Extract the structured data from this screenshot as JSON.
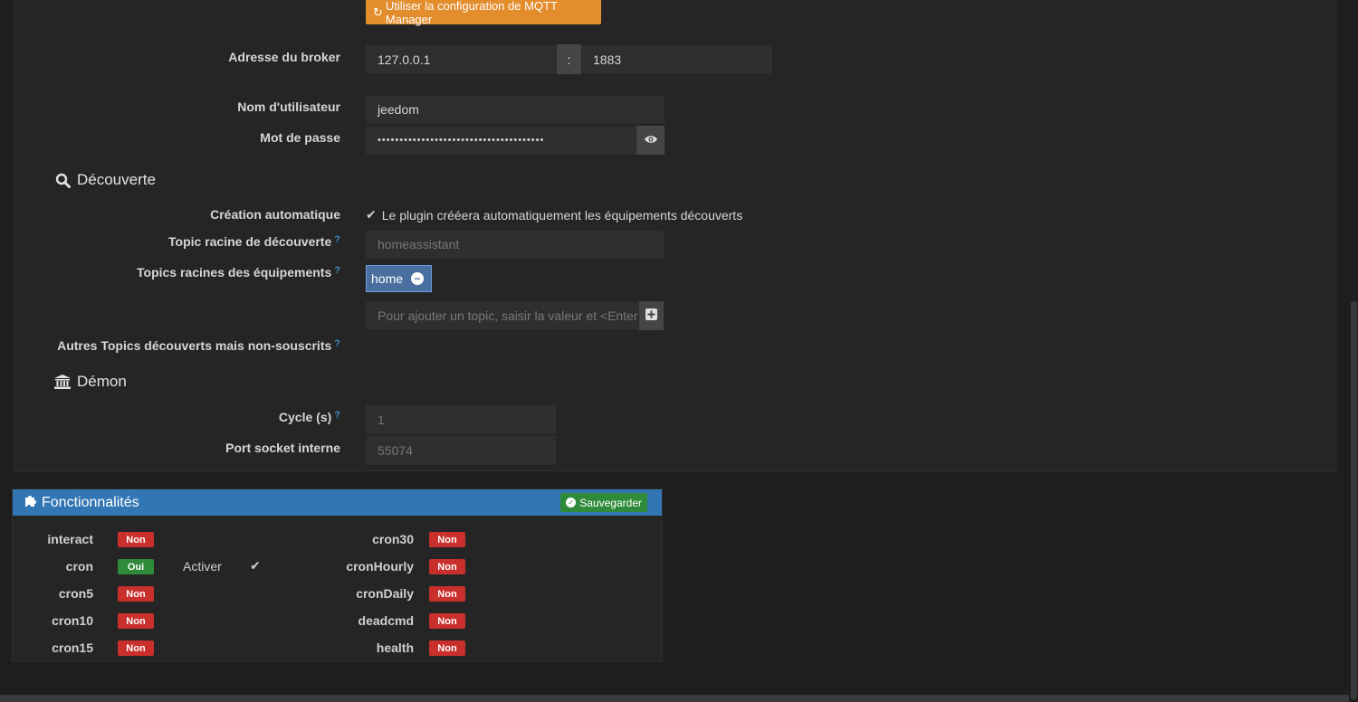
{
  "mqtt_button": {
    "icon": "refresh-icon",
    "label": "Utiliser la configuration de MQTT Manager"
  },
  "broker": {
    "label": "Adresse du broker",
    "host": "127.0.0.1",
    "separator": ":",
    "port": "1883"
  },
  "username": {
    "label": "Nom d'utilisateur",
    "value": "jeedom"
  },
  "password": {
    "label": "Mot de passe",
    "value": "••••••••••••••••••••••••••••••••••••••",
    "toggle_icon": "eye-icon"
  },
  "discovery": {
    "title": "Découverte",
    "icon": "search-icon",
    "auto_creation_label": "Création automatique",
    "auto_creation_text": "Le plugin crééera automatiquement les équipements découverts",
    "auto_creation_checked": true,
    "root_topic_label": "Topic racine de découverte",
    "root_topic_placeholder": "homeassistant",
    "equipment_topics_label": "Topics racines des équipements",
    "topics": [
      "home"
    ],
    "add_topic_placeholder": "Pour ajouter un topic, saisir la valeur et <Enter>",
    "other_topics_label": "Autres Topics découverts mais non-souscrits",
    "help_icon": "?"
  },
  "daemon": {
    "title": "Démon",
    "icon": "bank-icon",
    "cycle_label": "Cycle (s)",
    "cycle_placeholder": "1",
    "socket_label": "Port socket interne",
    "socket_placeholder": "55074"
  },
  "features": {
    "title": "Fonctionnalités",
    "icon": "puzzle-icon",
    "save_label": "Sauvegarder",
    "activate_label": "Activer",
    "left": [
      {
        "name": "interact",
        "status": "Non"
      },
      {
        "name": "cron",
        "status": "Oui"
      },
      {
        "name": "cron5",
        "status": "Non"
      },
      {
        "name": "cron10",
        "status": "Non"
      },
      {
        "name": "cron15",
        "status": "Non"
      }
    ],
    "right": [
      {
        "name": "cron30",
        "status": "Non"
      },
      {
        "name": "cronHourly",
        "status": "Non"
      },
      {
        "name": "cronDaily",
        "status": "Non"
      },
      {
        "name": "deadcmd",
        "status": "Non"
      },
      {
        "name": "health",
        "status": "Non"
      }
    ]
  },
  "colors": {
    "orange": "#e38d2c",
    "blue": "#3376b4",
    "red": "#c9302c",
    "green": "#2e8b3a"
  }
}
